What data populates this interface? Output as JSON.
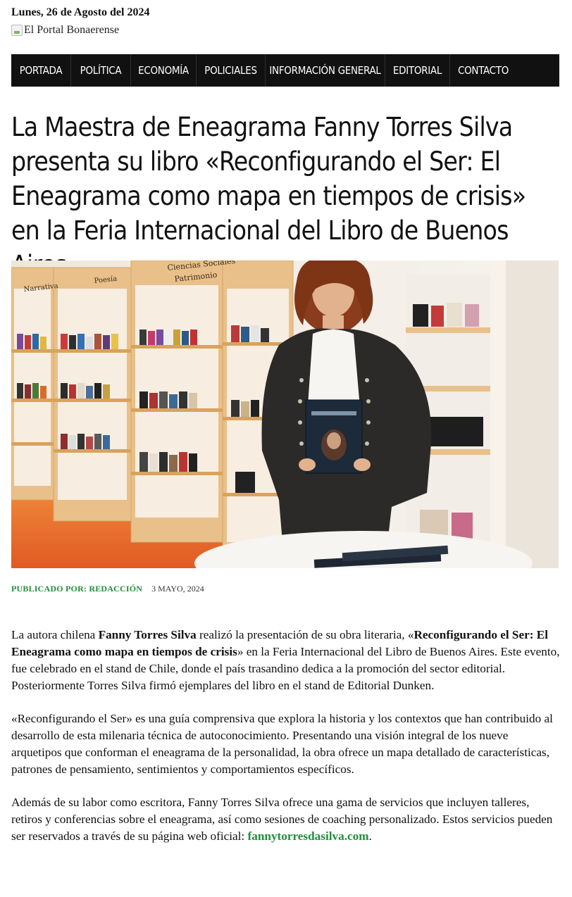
{
  "header": {
    "date": "Lunes, 26 de Agosto del 2024",
    "logo_alt": "El Portal Bonaerense"
  },
  "nav": {
    "items": [
      {
        "label": "PORTADA"
      },
      {
        "label": "POLÍTICA"
      },
      {
        "label": "ECONOMÍA"
      },
      {
        "label": "POLICIALES"
      },
      {
        "label": "INFORMACIÓN GENERAL"
      },
      {
        "label": "EDITORIAL"
      },
      {
        "label": "CONTACTO"
      }
    ]
  },
  "article": {
    "title": "La Maestra de Eneagrama Fanny Torres Silva presenta su libro «Reconfigurando el Ser: El Eneagrama como mapa en tiempos de crisis» en la Feria Internacional del Libro de Buenos Aires",
    "image": {
      "shelf_labels": [
        "Narrativa",
        "Poesía",
        "Ciencias Sociales",
        "Patrimonio"
      ]
    },
    "meta": {
      "published_by": "PUBLICADO POR: REDACCIÓN",
      "date": "3 MAYO, 2024"
    },
    "paragraphs": {
      "p1": {
        "a": "La autora chilena ",
        "b": "Fanny Torres Silva",
        "c": " realizó la presentación de su obra literaria, «",
        "d": "Reconfigurando el Ser: El Eneagrama como mapa en tiempos de crisis",
        "e": "» en la Feria Internacional del Libro de Buenos Aires. Este evento, fue celebrado en el stand de Chile, donde el país trasandino dedica a la promoción del sector editorial. Posteriormente Torres Silva firmó ejemplares del libro en el stand de Editorial Dunken."
      },
      "p2": "«Reconfigurando el Ser» es una guía comprensiva que explora la historia y los contextos que han contribuido al desarrollo de esta milenaria técnica de autoconocimiento. Presentando una visión integral de los nueve arquetipos que conforman el eneagrama de la personalidad, la obra ofrece un mapa detallado de características, patrones de pensamiento, sentimientos y comportamientos específicos.",
      "p3": {
        "a": "Además de su labor como escritora, Fanny Torres Silva ofrece una gama de servicios que incluyen talleres, retiros y conferencias sobre el eneagrama, así como sesiones de coaching personalizado. Estos servicios pueden ser reservados a través de su página web oficial: ",
        "link": "fannytorresdasilva.com",
        "end": "."
      }
    }
  },
  "colors": {
    "nav_bg": "#111111",
    "accent_green": "#1f8f3a"
  }
}
